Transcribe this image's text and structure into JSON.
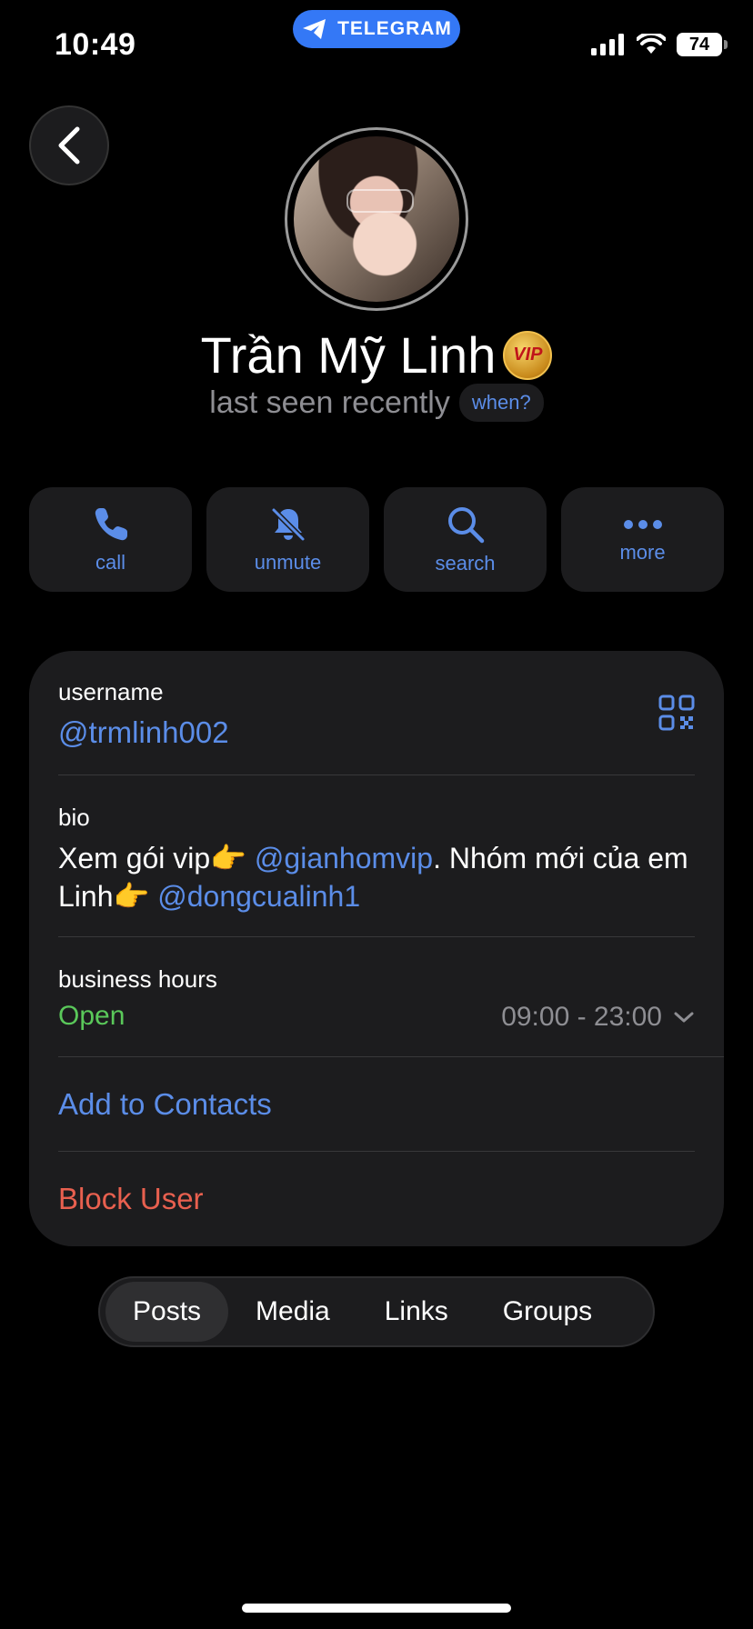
{
  "status_bar": {
    "time": "10:49",
    "app_name": "TELEGRAM",
    "battery": "74"
  },
  "profile": {
    "name": "Trần Mỹ Linh",
    "badge": "VIP",
    "last_seen": "last seen recently",
    "when_label": "when?"
  },
  "actions": [
    {
      "label": "call",
      "icon": "phone-icon"
    },
    {
      "label": "unmute",
      "icon": "bell-slash-icon"
    },
    {
      "label": "search",
      "icon": "search-icon"
    },
    {
      "label": "more",
      "icon": "more-icon"
    }
  ],
  "info": {
    "username_label": "username",
    "username_value": "@trmlinh002",
    "bio_label": "bio",
    "bio": {
      "part1": "Xem gói vip👉 ",
      "mention1": "@gianhomvip",
      "part2": ". Nhóm mới của em Linh👉 ",
      "mention2": "@dongcualinh1"
    },
    "business_hours_label": "business hours",
    "business_status": "Open",
    "business_hours": "09:00 - 23:00",
    "add_contacts": "Add to Contacts",
    "block_user": "Block User"
  },
  "tabs": [
    {
      "label": "Posts",
      "active": true
    },
    {
      "label": "Media",
      "active": false
    },
    {
      "label": "Links",
      "active": false
    },
    {
      "label": "Groups",
      "active": false
    }
  ],
  "colors": {
    "accent": "#5b8de8",
    "open": "#5ac85a",
    "danger": "#e8604f",
    "card": "#1c1c1e"
  }
}
